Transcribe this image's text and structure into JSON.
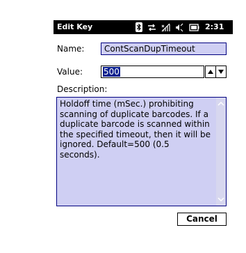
{
  "window": {
    "title": "Edit Key",
    "clock": "2:31",
    "status_icons": [
      "bluetooth-icon",
      "network-sync-icon",
      "signal-icon",
      "speaker-icon",
      "battery-icon"
    ]
  },
  "form": {
    "name_label": "Name:",
    "name_value": "ContScanDupTimeout",
    "value_label": "Value:",
    "value_value": "500",
    "description_label": "Description:",
    "description_text": "Holdoff time (mSec.) prohibiting\nscanning of duplicate barcodes. If a\nduplicate barcode is scanned within\nthe specified timeout, then it will be\nignored. Default=500 (0.5\nseconds)."
  },
  "buttons": {
    "cancel_label": "Cancel"
  },
  "colors": {
    "titlebar": "#000000",
    "field_fill": "#cfcff3",
    "selection": "#0a1f8f"
  }
}
